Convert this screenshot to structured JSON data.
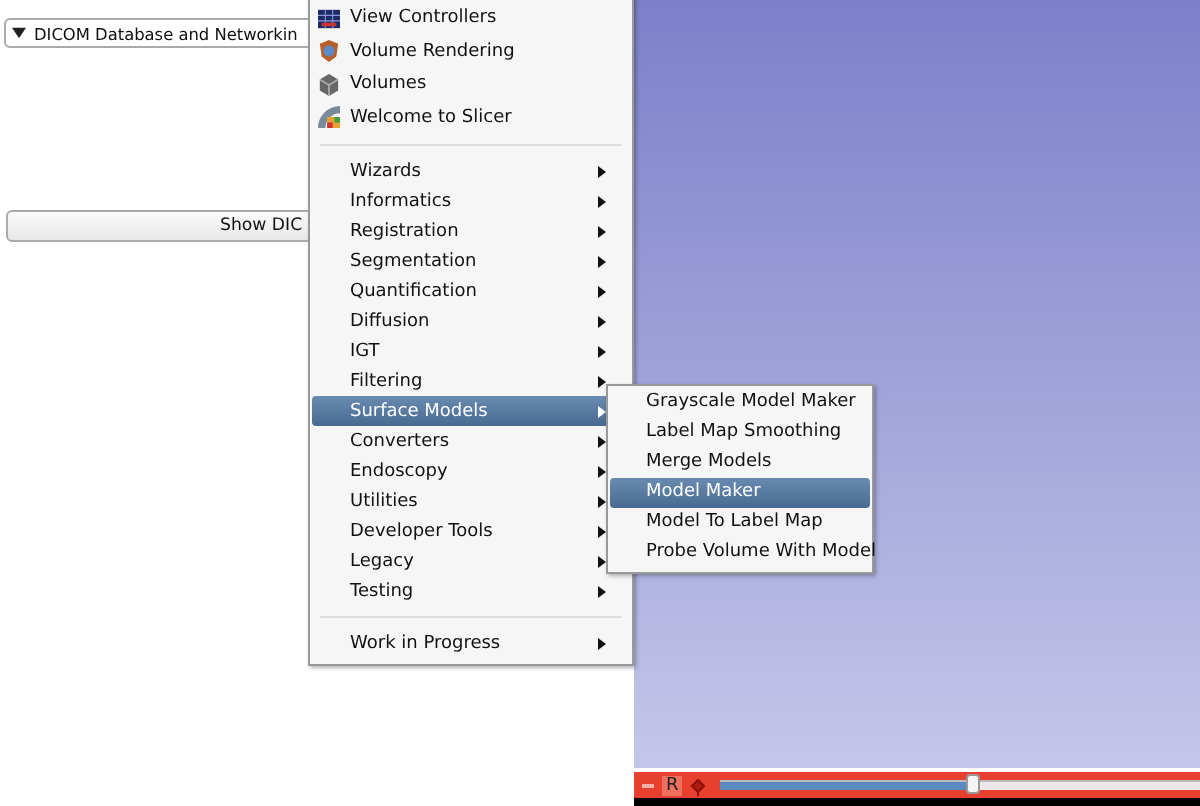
{
  "panel": {
    "section": {
      "title": "DICOM Database and Networkin",
      "expanded": true
    },
    "button": "Show DIC"
  },
  "menu": {
    "items": [
      {
        "kind": "module",
        "label": "View Controllers",
        "selected": false
      },
      {
        "kind": "module",
        "label": "Volume Rendering",
        "selected": false
      },
      {
        "kind": "module",
        "label": "Volumes",
        "selected": false
      },
      {
        "kind": "module",
        "label": "Welcome to Slicer",
        "selected": false
      },
      {
        "kind": "separator"
      },
      {
        "kind": "submenu",
        "label": "Wizards",
        "selected": false
      },
      {
        "kind": "submenu",
        "label": "Informatics",
        "selected": false
      },
      {
        "kind": "submenu",
        "label": "Registration",
        "selected": false
      },
      {
        "kind": "submenu",
        "label": "Segmentation",
        "selected": false
      },
      {
        "kind": "submenu",
        "label": "Quantification",
        "selected": false
      },
      {
        "kind": "submenu",
        "label": "Diffusion",
        "selected": false
      },
      {
        "kind": "submenu",
        "label": "IGT",
        "selected": false
      },
      {
        "kind": "submenu",
        "label": "Filtering",
        "selected": false
      },
      {
        "kind": "submenu",
        "label": "Surface Models",
        "selected": true
      },
      {
        "kind": "submenu",
        "label": "Converters",
        "selected": false
      },
      {
        "kind": "submenu",
        "label": "Endoscopy",
        "selected": false
      },
      {
        "kind": "submenu",
        "label": "Utilities",
        "selected": false
      },
      {
        "kind": "submenu",
        "label": "Developer Tools",
        "selected": false
      },
      {
        "kind": "submenu",
        "label": "Legacy",
        "selected": false
      },
      {
        "kind": "submenu",
        "label": "Testing",
        "selected": false
      },
      {
        "kind": "separator"
      },
      {
        "kind": "submenu",
        "label": "Work in Progress",
        "selected": false
      }
    ]
  },
  "submenu": {
    "items": [
      {
        "label": "Grayscale Model Maker",
        "selected": false
      },
      {
        "label": "Label Map Smoothing",
        "selected": false
      },
      {
        "label": "Merge Models",
        "selected": false
      },
      {
        "label": "Model Maker",
        "selected": true
      },
      {
        "label": "Model To Label Map",
        "selected": false
      },
      {
        "label": "Probe Volume With Model",
        "selected": false
      }
    ]
  },
  "slice_bar": {
    "label": "R",
    "level": 0.53
  }
}
